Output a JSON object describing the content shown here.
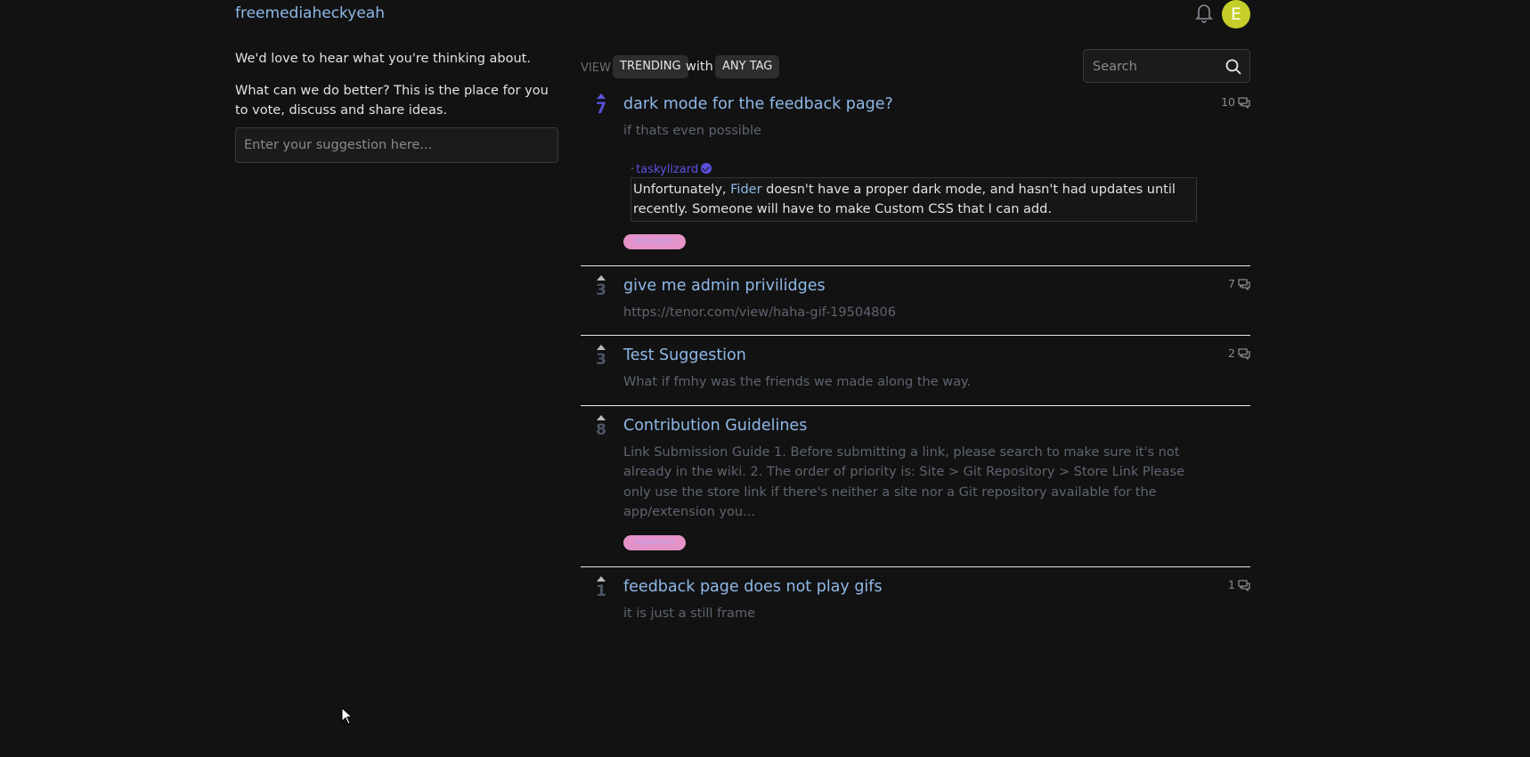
{
  "header": {
    "site_title": "freemediaheckyeah",
    "notifications_icon": "bell-icon",
    "avatar_letter": "E",
    "avatar_color": "#c6cf2a"
  },
  "sidebar": {
    "intro": "We'd love to hear what you're thinking about.",
    "description": "What can we do better? This is the place for you to vote, discuss and share ideas.",
    "suggestion_placeholder": "Enter your suggestion here..."
  },
  "filters": {
    "view_label": "VIEW",
    "view_value": "TRENDING",
    "with_label": "with",
    "tag_value": "ANY TAG",
    "search_placeholder": "Search",
    "search_icon": "search-icon"
  },
  "colors": {
    "background": "#121212",
    "link": "#8fb8e8",
    "accent": "#5b51e0",
    "tag": "#e592c9",
    "muted": "#5e6470"
  },
  "posts": [
    {
      "votes": "7",
      "voted": true,
      "title": "dark mode for the feedback page?",
      "description": "if thats even possible",
      "comments": "10",
      "response": {
        "author": "taskylizard",
        "text_before": "Unfortunately, ",
        "link_text": "Fider",
        "text_after": " doesn't have a proper dark mode, and hasn't had updates until recently. Someone will have to make Custom CSS that I can add."
      },
      "tag": "discussion"
    },
    {
      "votes": "3",
      "voted": false,
      "title": "give me admin privilidges",
      "description": "https://tenor.com/view/haha-gif-19504806",
      "comments": "7"
    },
    {
      "votes": "3",
      "voted": false,
      "title": "Test Suggestion",
      "description": "What if fmhy was the friends we made along the way.",
      "comments": "2"
    },
    {
      "votes": "8",
      "voted": false,
      "title": "Contribution Guidelines",
      "description": "Link Submission Guide 1. Before submitting a link, please search to make sure it's not already in the wiki. 2. The order of priority is: Site > Git Repository > Store Link Please only use the store link if there's neither a site nor a Git repository available for the app/extension you...",
      "comments": "",
      "tag": "important"
    },
    {
      "votes": "1",
      "voted": false,
      "title": "feedback page does not play gifs",
      "description": "it is just a still frame",
      "comments": "1"
    }
  ]
}
